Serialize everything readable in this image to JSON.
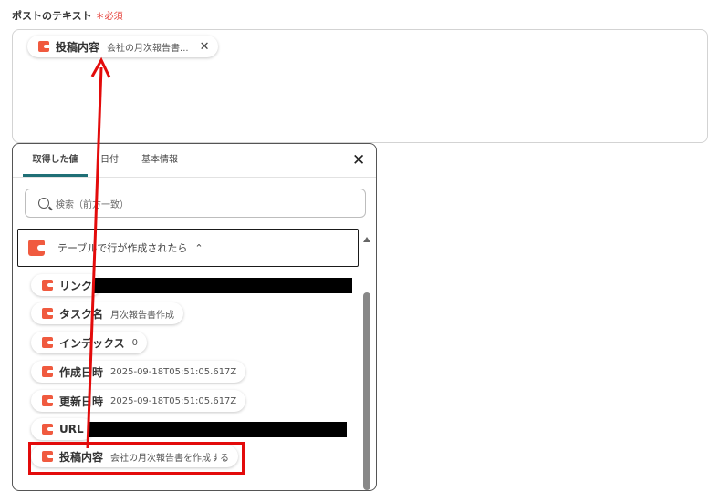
{
  "field": {
    "label": "ポストのテキスト",
    "required_mark": "＊必須"
  },
  "chip": {
    "name": "投稿内容",
    "value": "会社の月次報告書...",
    "close": "✕"
  },
  "panel": {
    "tabs": [
      "取得した値",
      "日付",
      "基本情報"
    ],
    "close": "✕",
    "search_placeholder": "検索（前方一致）",
    "group": {
      "label": "テーブルで行が作成されたら",
      "caret": "⌃"
    },
    "items": [
      {
        "name": "リンク",
        "value": "",
        "redacted": true
      },
      {
        "name": "タスク名",
        "value": "月次報告書作成"
      },
      {
        "name": "インデックス",
        "value": "0"
      },
      {
        "name": "作成日時",
        "value": "2025-09-18T05:51:05.617Z"
      },
      {
        "name": "更新日時",
        "value": "2025-09-18T05:51:05.617Z"
      },
      {
        "name": "URL",
        "value": "",
        "redacted": true
      },
      {
        "name": "投稿内容",
        "value": "会社の月次報告書を作成する",
        "highlighted": true
      }
    ]
  },
  "colors": {
    "accent": "#1f6f76",
    "icon": "#f05a3f",
    "highlight": "#e30b0b",
    "required": "#e5403a"
  }
}
